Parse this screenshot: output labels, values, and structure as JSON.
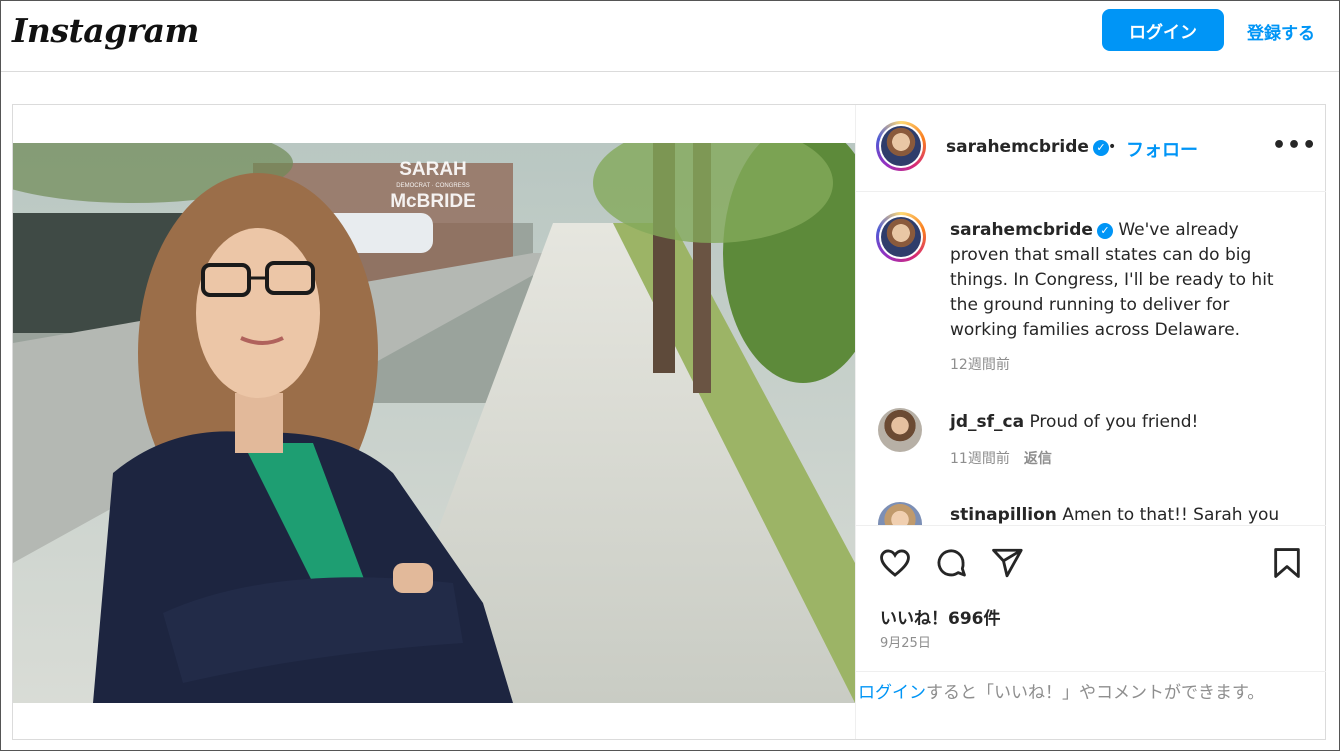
{
  "header": {
    "logo_text": "Instagram",
    "login_label": "ログイン",
    "signup_label": "登録する"
  },
  "post": {
    "media": {
      "overlay_line1": "SARAH",
      "overlay_line2": "DEMOCRAT · CONGRESS",
      "overlay_line3": "McBRIDE"
    },
    "author": {
      "username": "sarahemcbride",
      "separator": "•",
      "follow_label": "フォロー",
      "more_label": "•••"
    },
    "caption": {
      "username": "sarahemcbride",
      "text": "We've already proven that small states can do big things. In Congress, I'll be ready to hit the ground running to deliver for working families across Delaware.",
      "time": "12週間前"
    },
    "comments": [
      {
        "username": "jd_sf_ca",
        "text": "Proud of you friend!",
        "time": "11週間前",
        "reply_label": "返信"
      },
      {
        "username": "stinapillion",
        "text": "Amen to that!! Sarah you"
      }
    ],
    "likes_label": "いいね！696件",
    "date": "9月25日",
    "login_prompt": {
      "link": "ログイン",
      "rest": "すると「いいね！」やコメントができます。"
    }
  },
  "colors": {
    "accent": "#0095f6",
    "text": "#262626",
    "muted": "#8e8e8e",
    "border": "#dbdbdb"
  },
  "icons": [
    "verified-badge-icon",
    "more-options-icon",
    "heart-icon",
    "comment-icon",
    "share-icon",
    "bookmark-icon"
  ]
}
